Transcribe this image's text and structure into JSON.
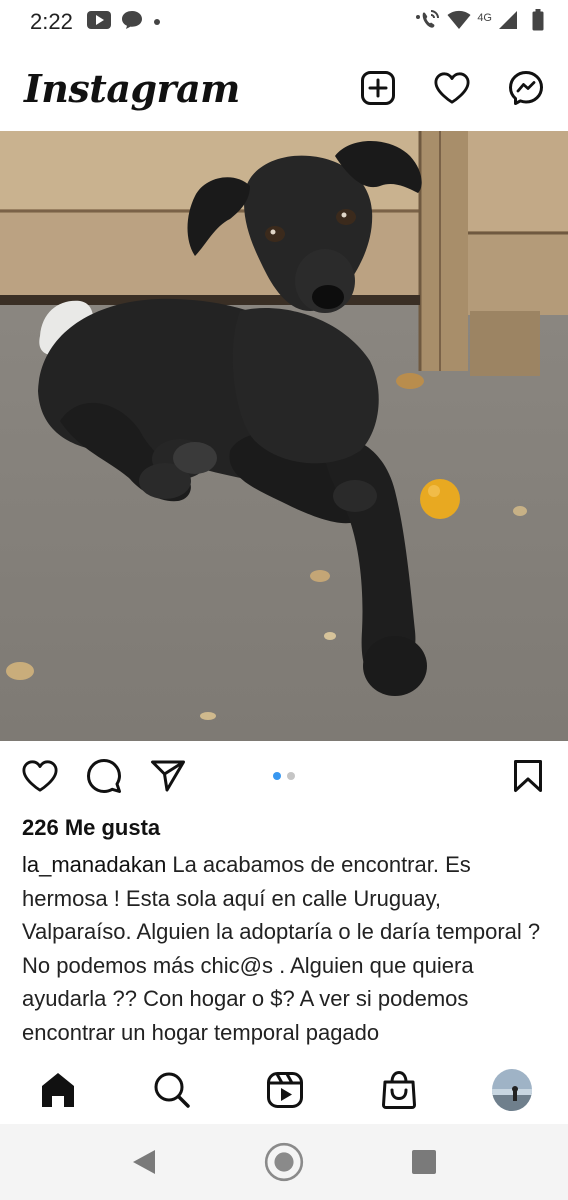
{
  "status_bar": {
    "time": "2:22",
    "network": "4G",
    "icons": [
      "youtube-icon",
      "chat-bubble-icon",
      "dot-icon",
      "wifi-call-icon",
      "wifi-icon",
      "signal-icon",
      "battery-icon"
    ]
  },
  "app_bar": {
    "logo": "Instagram",
    "actions": [
      "add-post-icon",
      "heart-icon",
      "messenger-icon"
    ]
  },
  "post": {
    "image": "black-puppy-photo",
    "carousel": {
      "count": 2,
      "active_index": 0
    },
    "actions": [
      "like-icon",
      "comment-icon",
      "share-icon",
      "save-icon"
    ],
    "likes": "226 Me gusta",
    "username": "la_manadakan",
    "caption": "La acabamos de encontrar. Es hermosa ! Esta sola aquí en calle Uruguay, Valparaíso. Alguien la adoptaría o le daría temporal ? No podemos más chic@s . Alguien que quiera ayudarla ?? Con hogar o $? A ver si podemos encontrar un hogar temporal pagado"
  },
  "bottom_nav": [
    "home-icon",
    "search-icon",
    "reels-icon",
    "shop-icon",
    "profile-avatar"
  ],
  "system_nav": [
    "back-button",
    "home-button",
    "recents-button"
  ],
  "colors": {
    "accent": "#3897f0",
    "text": "#111111",
    "nav_bar": "#f4f4f4"
  }
}
